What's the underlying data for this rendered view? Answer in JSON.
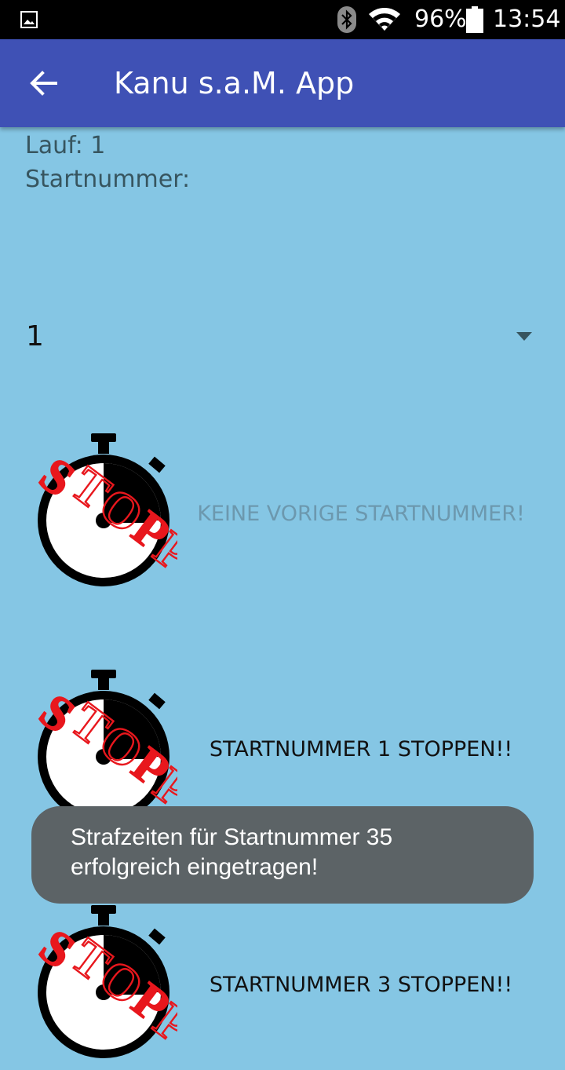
{
  "status_bar": {
    "battery_percent": "96%",
    "time": "13:54",
    "icons": [
      "gallery-notification-icon",
      "bluetooth-icon",
      "wifi-icon",
      "battery-icon"
    ]
  },
  "app_bar": {
    "title": "Kanu s.a.M. App",
    "back_icon": "arrow-back-icon",
    "color": "#3f51b5"
  },
  "info": {
    "lauf": "Lauf: 1",
    "startnummer": "Startnummer:"
  },
  "spinner": {
    "selected": "1"
  },
  "actions": [
    {
      "label": "KEINE VORIGE STARTNUMMER!",
      "enabled": false
    },
    {
      "label": "STARTNUMMER 1 STOPPEN!!",
      "enabled": true
    },
    {
      "label": "STARTNUMMER 3 STOPPEN!!",
      "enabled": true
    }
  ],
  "stopwatch_stamp_text": "STOPP",
  "toast": {
    "message": "Strafzeiten für Startnummer 35 erfolgreich eingetragen!"
  },
  "colors": {
    "background": "#85c6e4",
    "toast": "#5c6366",
    "stamp_red": "#e8171d"
  }
}
